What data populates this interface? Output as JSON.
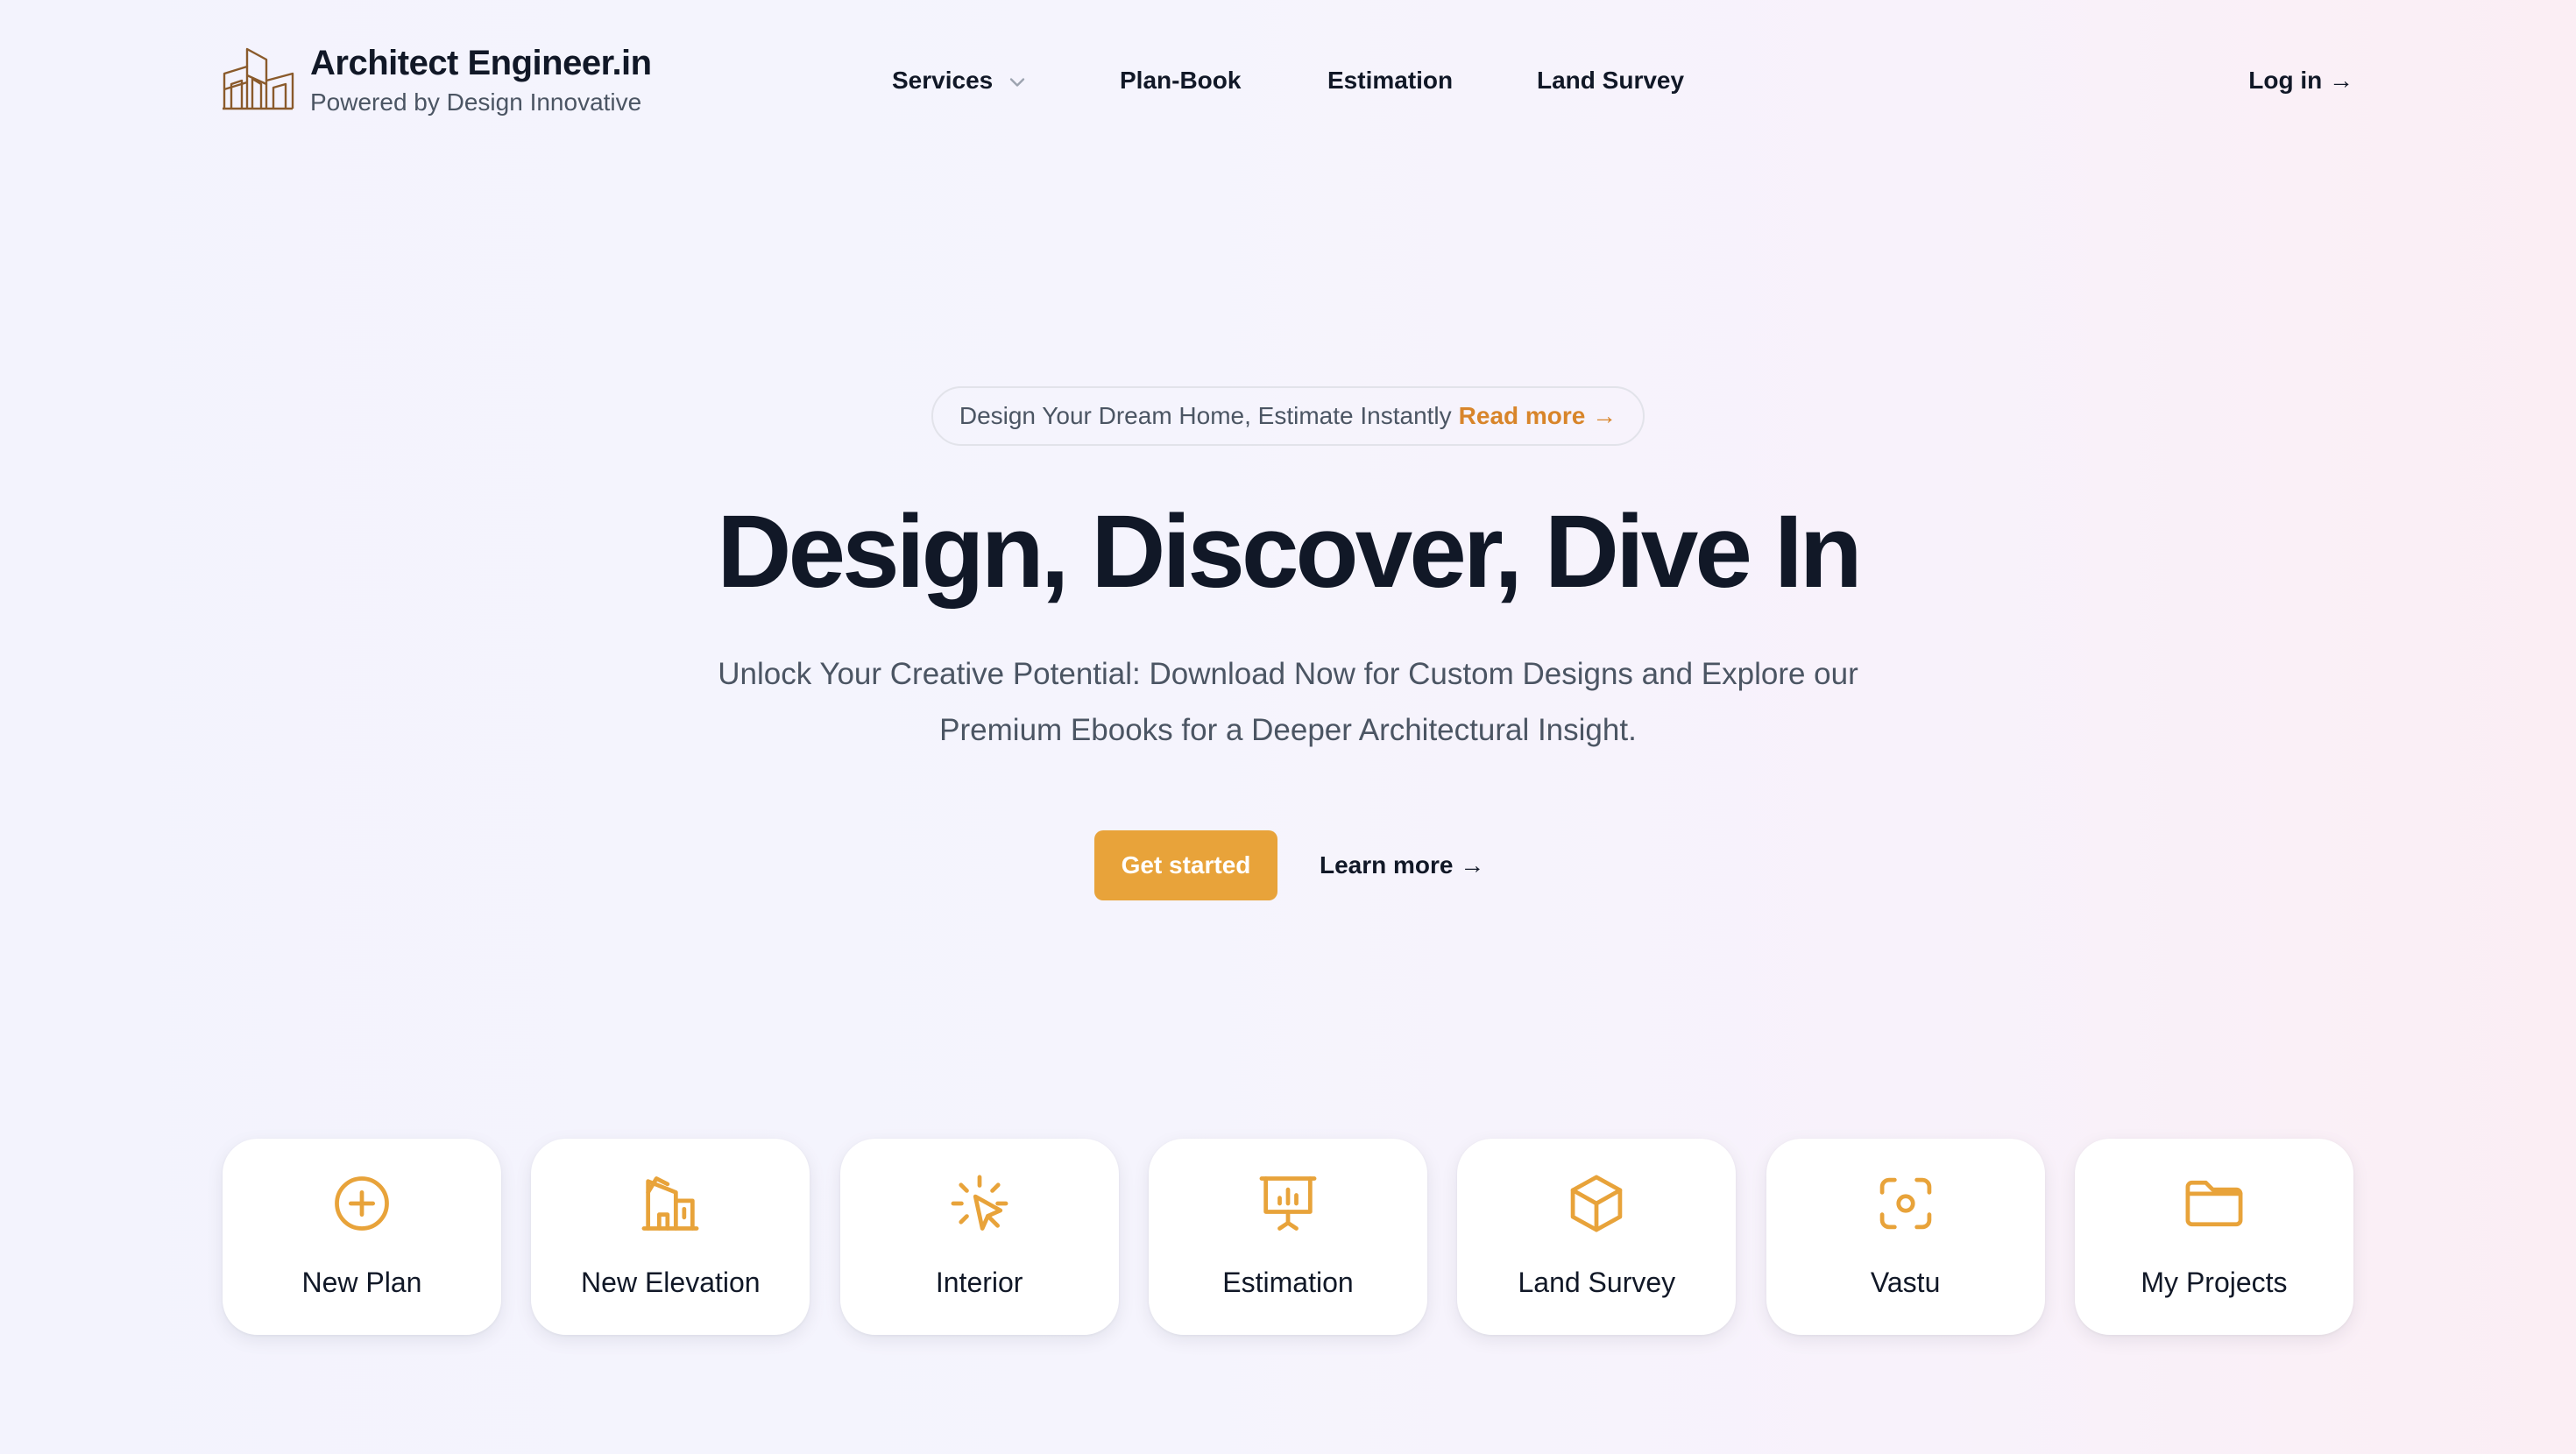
{
  "brand": {
    "name": "Architect Engineer.in",
    "tagline": "Powered by Design Innovative",
    "logo_icon": "building-outline-icon"
  },
  "nav": {
    "items": [
      {
        "label": "Services",
        "has_dropdown": true
      },
      {
        "label": "Plan-Book"
      },
      {
        "label": "Estimation"
      },
      {
        "label": "Land Survey"
      }
    ],
    "login_label": "Log in →"
  },
  "hero": {
    "announcement": "Design Your Dream Home, Estimate Instantly",
    "announcement_link": "Read more →",
    "title": "Design, Discover, Dive In",
    "subtitle": "Unlock Your Creative Potential: Download Now for Custom Designs and Explore our Premium Ebooks for a Deeper Architectural Insight.",
    "primary_cta": "Get started",
    "secondary_cta": "Learn more →"
  },
  "quick_actions": [
    {
      "label": "New Plan",
      "icon": "plus-circle-icon"
    },
    {
      "label": "New Elevation",
      "icon": "building-icon"
    },
    {
      "label": "Interior",
      "icon": "cursor-click-icon"
    },
    {
      "label": "Estimation",
      "icon": "presentation-chart-icon"
    },
    {
      "label": "Land Survey",
      "icon": "cube-icon"
    },
    {
      "label": "Vastu",
      "icon": "viewfinder-circle-icon"
    },
    {
      "label": "My Projects",
      "icon": "folder-icon"
    }
  ],
  "colors": {
    "accent": "#e8a33a",
    "link": "#d8852a",
    "text": "#111827",
    "muted": "#4b5563",
    "logo": "#8a5a2b"
  }
}
